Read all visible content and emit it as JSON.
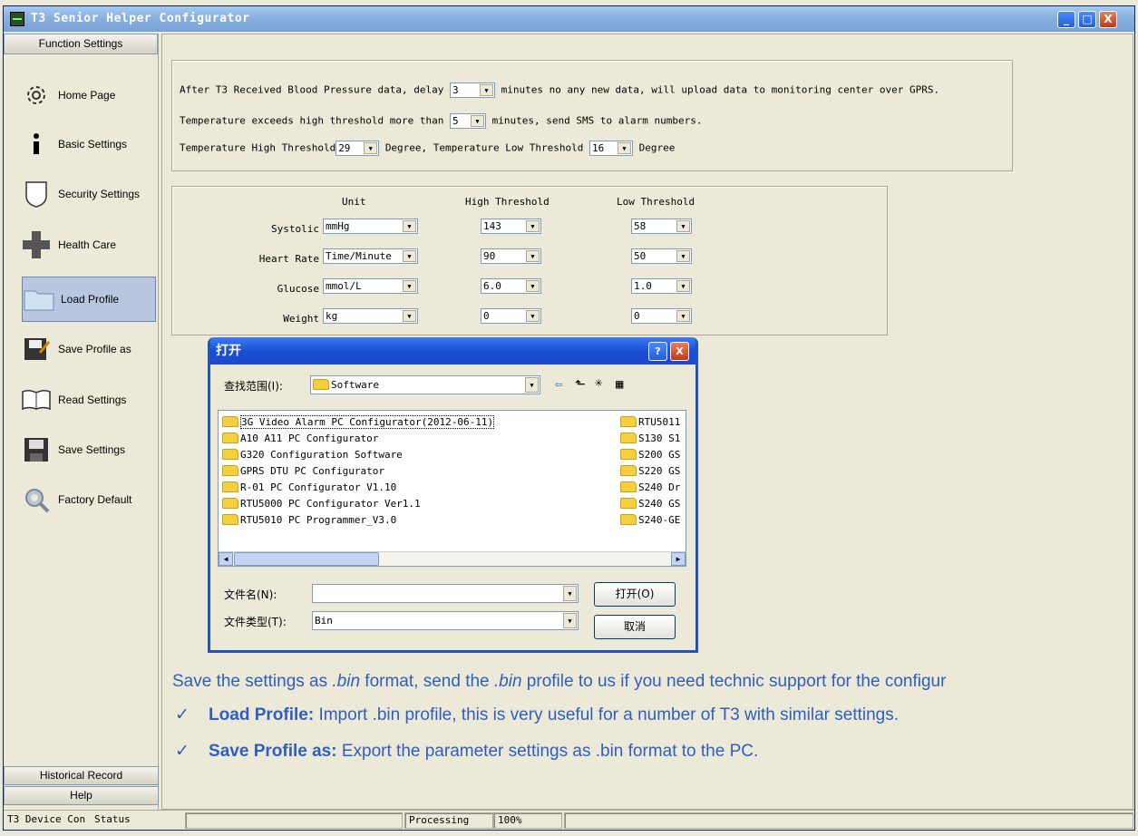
{
  "window": {
    "title": "T3 Senior Helper Configurator",
    "min": "_",
    "max": "□",
    "close": "X"
  },
  "sidebar": {
    "header": "Function Settings",
    "items": [
      {
        "label": "Home Page",
        "icon": "gear-icon"
      },
      {
        "label": "Basic  Settings",
        "icon": "info-icon"
      },
      {
        "label": "Security Settings",
        "icon": "shield-icon"
      },
      {
        "label": "Health   Care",
        "icon": "plus-icon"
      },
      {
        "label": "Load   Profile",
        "icon": "folder-icon"
      },
      {
        "label": "Save Profile as",
        "icon": "save-as-icon"
      },
      {
        "label": "Read Settings",
        "icon": "book-icon"
      },
      {
        "label": "Save Settings",
        "icon": "disk-icon"
      },
      {
        "label": "Factory Default",
        "icon": "wrench-icon"
      }
    ],
    "footer1": "Historical Record",
    "footer2": "Help"
  },
  "settings": {
    "line1_pre": "After T3 Received Blood Pressure data, delay",
    "line1_val": "3",
    "line1_post": "minutes no any new data, will upload data to monitoring center over GPRS.",
    "line2_pre": "Temperature exceeds high threshold more than",
    "line2_val": "5",
    "line2_post": "minutes, send SMS to alarm numbers.",
    "line3_pre": "Temperature High Threshold",
    "line3_val": "29",
    "line3_mid": "Degree,   Temperature Low Threshold",
    "line3_val2": "16",
    "line3_post": "Degree"
  },
  "thresholds": {
    "headers": {
      "unit": "Unit",
      "high": "High Threshold",
      "low": "Low Threshold"
    },
    "rows": [
      {
        "name": "Systolic",
        "unit": "mmHg",
        "high": "143",
        "low": "58"
      },
      {
        "name": "Heart Rate",
        "unit": "Time/Minute",
        "high": "90",
        "low": "50"
      },
      {
        "name": "Glucose",
        "unit": "mmol/L",
        "high": "6.0",
        "low": "1.0"
      },
      {
        "name": "Weight",
        "unit": "kg",
        "high": "0",
        "low": "0"
      }
    ]
  },
  "dialog": {
    "title": "打开",
    "help": "?",
    "close": "X",
    "lookin_label": "查找范围(I):",
    "lookin_value": "Software",
    "left_files": [
      "3G Video Alarm PC Configurator(2012-06-11)",
      "A10 A11  PC Configurator",
      "G320 Configuration Software",
      "GPRS DTU PC Configurator",
      "R-01 PC Configurator V1.10",
      "RTU5000 PC Configurator Ver1.1",
      "RTU5010 PC Programmer_V3.0"
    ],
    "right_files": [
      "RTU5011",
      "S130 S1",
      "S200 GS",
      "S220 GS",
      "S240 Dr",
      "S240 GS",
      "S240-GE"
    ],
    "filename_label": "文件名(N):",
    "filename_value": "",
    "filetype_label": "文件类型(T):",
    "filetype_value": "Bin",
    "open_btn": "打开(O)",
    "cancel_btn": "取消"
  },
  "doc": {
    "line1_a": "Save the settings as ",
    "line1_b": ".bin",
    "line1_c": " format, send the ",
    "line1_d": ".bin",
    "line1_e": " profile to us if you need technic support for the configur",
    "b1_bold": "Load Profile:",
    "b1_text": " Import .bin profile, this is very useful for a number of T3 with similar settings.",
    "b2_bold": "Save Profile as:",
    "b2_text": " Export the parameter settings as .bin format to the PC.",
    "check": "✓"
  },
  "status": {
    "p1": "T3 Device Con",
    "p2": "Status",
    "p3": "Processing",
    "p4": "100%"
  }
}
